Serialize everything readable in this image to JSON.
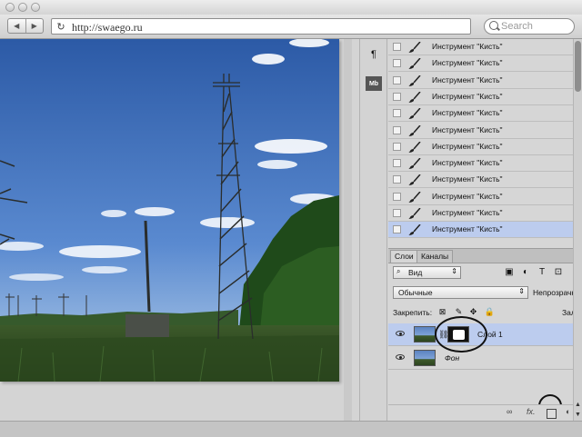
{
  "browser": {
    "url": "http://swaego.ru",
    "search_placeholder": "Search",
    "back_icon": "back-arrow-icon",
    "forward_icon": "forward-arrow-icon",
    "reload_icon": "reload-icon"
  },
  "side_strip": {
    "paragraph_glyph": "¶",
    "mb_glyph": "Mb"
  },
  "history": {
    "items": [
      "Инструмент \"Кисть\"",
      "Инструмент \"Кисть\"",
      "Инструмент \"Кисть\"",
      "Инструмент \"Кисть\"",
      "Инструмент \"Кисть\"",
      "Инструмент \"Кисть\"",
      "Инструмент \"Кисть\"",
      "Инструмент \"Кисть\"",
      "Инструмент \"Кисть\"",
      "Инструмент \"Кисть\"",
      "Инструмент \"Кисть\"",
      "Инструмент \"Кисть\""
    ],
    "selected_index": 11
  },
  "layers": {
    "tabs": [
      "Слои",
      "Каналы"
    ],
    "filter_label": "Вид",
    "blend_mode": "Обычные",
    "opacity_label": "Непрозрачн",
    "lock_label": "Закрепить:",
    "fill_label": "Зал",
    "items": [
      {
        "name": "Слой 1",
        "selected": true,
        "has_mask": true
      },
      {
        "name": "Фон",
        "selected": false,
        "has_mask": false
      }
    ]
  },
  "bottom_bar": {
    "link_label": "∞",
    "fx_label": "fx."
  },
  "colors": {
    "selection": "#bcccee",
    "panel_bg": "#d6d6d6",
    "sky": "#3d6bb3"
  }
}
